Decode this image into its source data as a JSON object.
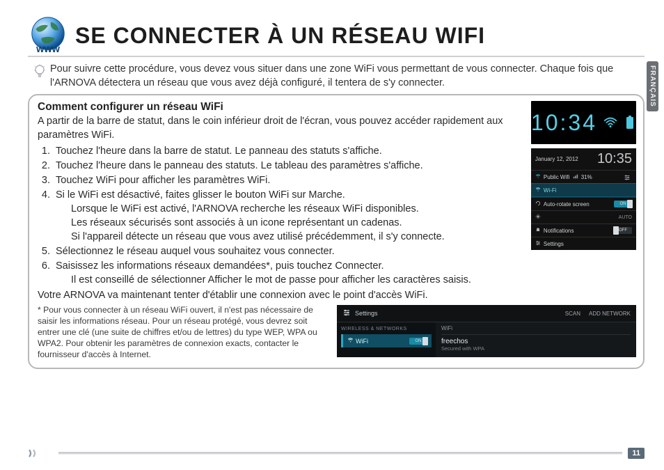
{
  "title": "SE CONNECTER À UN RÉSEAU WIFI",
  "globe_label": "www",
  "lang_tab": "FRANÇAIS",
  "intro": "Pour suivre cette procédure, vous devez vous situer dans une zone WiFi vous permettant de vous connecter. Chaque fois que l'ARNOVA détectera un réseau que vous avez déjà configuré, il tentera de s'y connecter.",
  "section_title": "Comment configurer un réseau WiFi",
  "lead": "A partir de la barre de statut, dans le coin inférieur droit de l'écran, vous pouvez accéder rapidement aux paramètres WiFi.",
  "steps": {
    "s1": "Touchez l'heure dans la barre de statut. Le panneau des statuts s'affiche.",
    "s2": "Touchez l'heure dans le panneau des statuts. Le tableau des paramètres s'affiche.",
    "s3": "Touchez WiFi pour afficher les paramètres WiFi.",
    "s4": "Si le WiFi est désactivé, faites glisser le bouton WiFi sur Marche.",
    "s4a": "Lorsque le WiFi est activé, l'ARNOVA recherche les réseaux WiFi disponibles.",
    "s4b": " Les réseaux sécurisés sont associés à un icone représentant un cadenas.",
    "s4c": "Si l'appareil détecte un réseau que vous avez utilisé précédemment, il s'y connecte.",
    "s5": "Sélectionnez le réseau auquel vous souhaitez vous connecter.",
    "s6": "Saisissez les informations réseaux demandées*, puis touchez Connecter.",
    "s6a": "Il est conseillé de sélectionner Afficher le mot de passe pour afficher les caractères saisis."
  },
  "post": "Votre ARNOVA va maintenant tenter d'établir une connexion avec le point d'accès WiFi.",
  "footnote": "* Pour vous connecter à un réseau WiFi ouvert, il n'est pas nécessaire de saisir les informations réseau. Pour un réseau protégé, vous devrez soit entrer une clé (une suite de chiffres et/ou de lettres) du type WEP, WPA ou WPA2. Pour obtenir les paramètres de connexion exacts, contacter le fournisseur d'accès à Internet.",
  "page_number": "11",
  "shot1": {
    "time": "10:34"
  },
  "shot2": {
    "date": "January 12, 2012",
    "time": "10:35",
    "network_name": "Public Wifi",
    "signal": "31%",
    "items": {
      "wifi": "Wi-Fi",
      "rotate": "Auto-rotate screen",
      "auto": "AUTO",
      "notif": "Notifications",
      "settings": "Settings"
    },
    "on": "ON",
    "off": "OFF"
  },
  "shot3": {
    "title": "Settings",
    "scan": "SCAN",
    "add": "ADD NETWORK",
    "cat": "WIRELESS & NETWORKS",
    "wifi": "WiFi",
    "on": "ON",
    "main_header": "WiFi",
    "net_name": "freechos",
    "net_sub": "Secured with WPA"
  }
}
